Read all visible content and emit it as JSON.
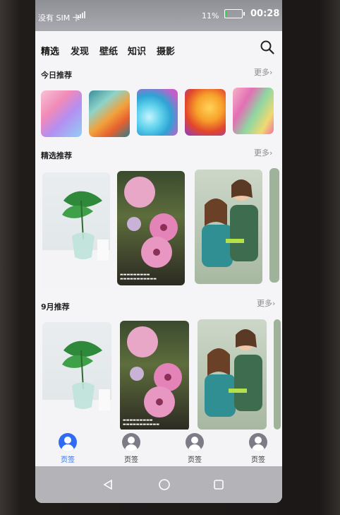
{
  "status_bar": {
    "carrier": "没有 SIM 卡",
    "battery_percent": "11%",
    "battery_level": 0.11,
    "time": "00:28"
  },
  "top_tabs": [
    "精选",
    "发现",
    "壁纸",
    "知识",
    "摄影"
  ],
  "active_tab_index": 0,
  "search": {
    "icon": "search-icon"
  },
  "sections": {
    "today": {
      "title": "今日推荐",
      "more": "更多"
    },
    "featured": {
      "title": "精选推荐",
      "more": "更多"
    },
    "september": {
      "title": "9月推荐",
      "more": "更多"
    }
  },
  "bottom_tabs": [
    {
      "label": "页签",
      "active": true
    },
    {
      "label": "页签",
      "active": false
    },
    {
      "label": "页签",
      "active": false
    },
    {
      "label": "页签",
      "active": false
    }
  ],
  "colors": {
    "accent": "#2f6cf3",
    "inactive": "#7c7c86",
    "status_bar": "#9a9ba1",
    "battery_fill": "#39d353"
  }
}
